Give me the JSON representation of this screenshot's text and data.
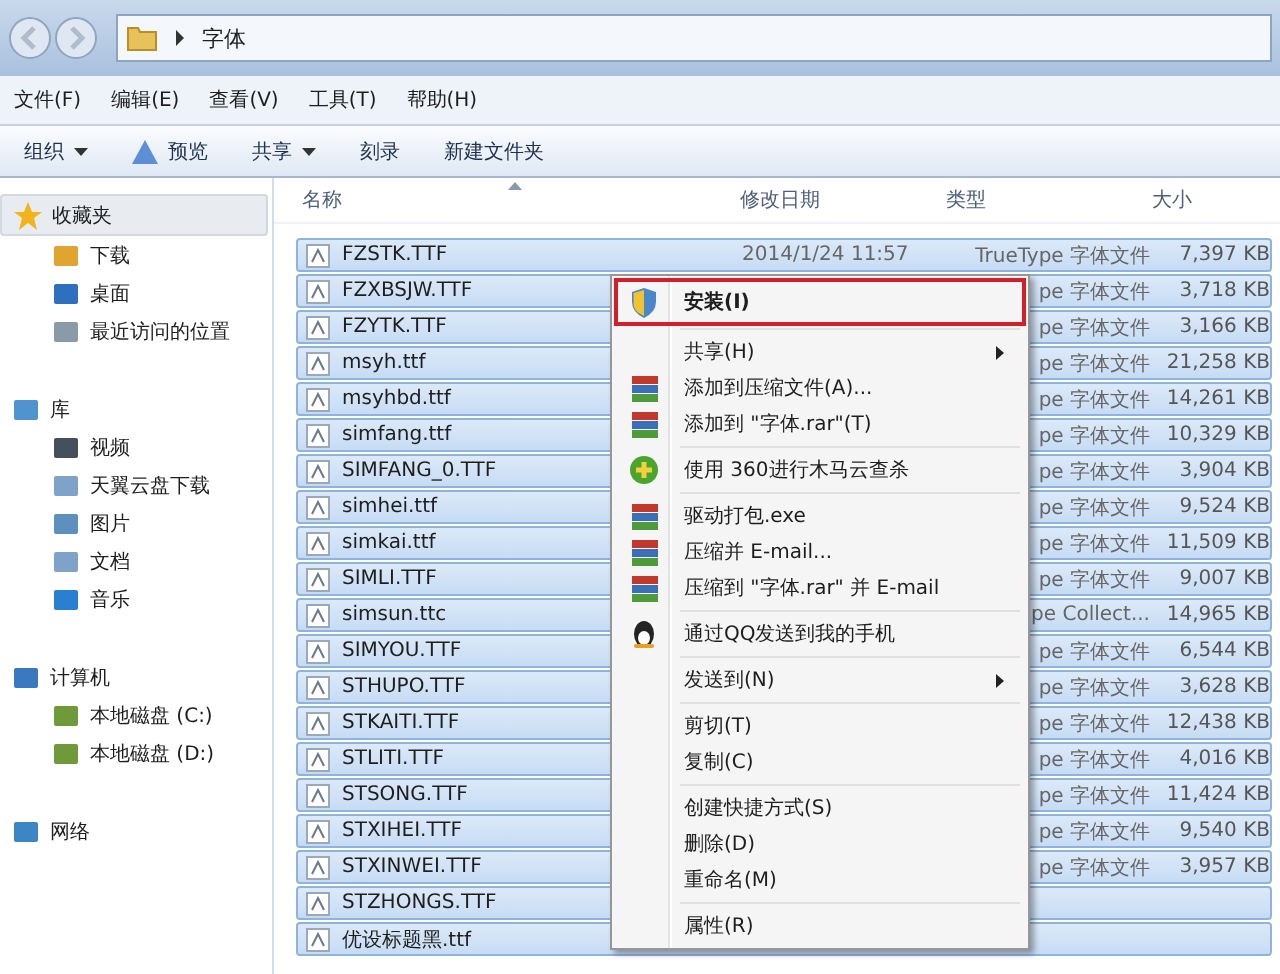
{
  "address": {
    "crumbs": [
      "字体"
    ]
  },
  "menubar": [
    "文件(F)",
    "编辑(E)",
    "查看(V)",
    "工具(T)",
    "帮助(H)"
  ],
  "toolbar": [
    {
      "label": "组织",
      "kind": "dropdown"
    },
    {
      "label": "预览",
      "kind": "preview"
    },
    {
      "label": "共享",
      "kind": "dropdown"
    },
    {
      "label": "刻录",
      "kind": "plain"
    },
    {
      "label": "新建文件夹",
      "kind": "plain"
    }
  ],
  "sidebar": [
    {
      "label": "收藏夹",
      "kind": "star",
      "selected": true,
      "children": [
        {
          "label": "下载",
          "kind": "download",
          "selected": false
        },
        {
          "label": "桌面",
          "kind": "desktop",
          "selected": false
        },
        {
          "label": "最近访问的位置",
          "kind": "recent",
          "selected": false
        }
      ]
    },
    {
      "label": "库",
      "kind": "library",
      "selected": false,
      "children": [
        {
          "label": "视频",
          "kind": "video",
          "selected": false
        },
        {
          "label": "天翼云盘下载",
          "kind": "doc",
          "selected": false
        },
        {
          "label": "图片",
          "kind": "picture",
          "selected": false
        },
        {
          "label": "文档",
          "kind": "doc",
          "selected": false
        },
        {
          "label": "音乐",
          "kind": "music",
          "selected": false
        }
      ]
    },
    {
      "label": "计算机",
      "kind": "computer",
      "selected": false,
      "children": [
        {
          "label": "本地磁盘 (C:)",
          "kind": "drive",
          "selected": false
        },
        {
          "label": "本地磁盘 (D:)",
          "kind": "drive",
          "selected": false
        }
      ]
    },
    {
      "label": "网络",
      "kind": "network",
      "selected": false
    }
  ],
  "table": {
    "columns": [
      {
        "label": "名称",
        "sorted": true
      },
      {
        "label": "修改日期",
        "sorted": false
      },
      {
        "label": "类型",
        "sorted": false
      },
      {
        "label": "大小",
        "sorted": false
      }
    ],
    "rows": [
      {
        "name": "FZSTK.TTF",
        "date": "2014/1/24 11:57",
        "type": "TrueType 字体文件",
        "size": "7,397 KB",
        "selected": true
      },
      {
        "name": "FZXBSJW.TTF",
        "type": "pe 字体文件",
        "size": "3,718 KB",
        "selected": true
      },
      {
        "name": "FZYTK.TTF",
        "type": "pe 字体文件",
        "size": "3,166 KB",
        "selected": true
      },
      {
        "name": "msyh.ttf",
        "type": "pe 字体文件",
        "size": "21,258 KB",
        "selected": true
      },
      {
        "name": "msyhbd.ttf",
        "type": "pe 字体文件",
        "size": "14,261 KB",
        "selected": true
      },
      {
        "name": "simfang.ttf",
        "type": "pe 字体文件",
        "size": "10,329 KB",
        "selected": true
      },
      {
        "name": "SIMFANG_0.TTF",
        "type": "pe 字体文件",
        "size": "3,904 KB",
        "selected": true
      },
      {
        "name": "simhei.ttf",
        "type": "pe 字体文件",
        "size": "9,524 KB",
        "selected": true
      },
      {
        "name": "simkai.ttf",
        "type": "pe 字体文件",
        "size": "11,509 KB",
        "selected": true
      },
      {
        "name": "SIMLI.TTF",
        "type": "pe 字体文件",
        "size": "9,007 KB",
        "selected": true
      },
      {
        "name": "simsun.ttc",
        "type": "pe Collect...",
        "size": "14,965 KB",
        "selected": true
      },
      {
        "name": "SIMYOU.TTF",
        "type": "pe 字体文件",
        "size": "6,544 KB",
        "selected": true
      },
      {
        "name": "STHUPO.TTF",
        "type": "pe 字体文件",
        "size": "3,628 KB",
        "selected": true
      },
      {
        "name": "STKAITI.TTF",
        "type": "pe 字体文件",
        "size": "12,438 KB",
        "selected": true
      },
      {
        "name": "STLITI.TTF",
        "type": "pe 字体文件",
        "size": "4,016 KB",
        "selected": true
      },
      {
        "name": "STSONG.TTF",
        "type": "pe 字体文件",
        "size": "11,424 KB",
        "selected": true
      },
      {
        "name": "STXIHEI.TTF",
        "type": "pe 字体文件",
        "size": "9,540 KB",
        "selected": true
      },
      {
        "name": "STXINWEI.TTF",
        "type": "pe 字体文件",
        "size": "3,957 KB",
        "selected": true
      },
      {
        "name": "STZHONGS.TTF",
        "selected": true
      },
      {
        "name": "优设标题黑.ttf",
        "selected": true
      }
    ]
  },
  "context_menu": [
    {
      "label": "安装(I)",
      "kind": "shield",
      "default": true,
      "highlighted": true
    },
    {
      "kind": "separator"
    },
    {
      "label": "共享(H)",
      "kind": "submenu"
    },
    {
      "label": "添加到压缩文件(A)...",
      "kind": "archive"
    },
    {
      "label": "添加到 \"字体.rar\"(T)",
      "kind": "archive"
    },
    {
      "kind": "separator"
    },
    {
      "label": "使用 360进行木马云查杀",
      "kind": "antivirus"
    },
    {
      "kind": "separator"
    },
    {
      "label": "驱动打包.exe",
      "kind": "archive"
    },
    {
      "label": "压缩并 E-mail...",
      "kind": "archive"
    },
    {
      "label": "压缩到 \"字体.rar\" 并 E-mail",
      "kind": "archive"
    },
    {
      "kind": "separator"
    },
    {
      "label": "通过QQ发送到我的手机",
      "kind": "penguin"
    },
    {
      "kind": "separator"
    },
    {
      "label": "发送到(N)",
      "kind": "submenu"
    },
    {
      "kind": "separator"
    },
    {
      "label": "剪切(T)",
      "kind": "plain"
    },
    {
      "label": "复制(C)",
      "kind": "plain"
    },
    {
      "kind": "separator"
    },
    {
      "label": "创建快捷方式(S)",
      "kind": "plain"
    },
    {
      "label": "删除(D)",
      "kind": "plain"
    },
    {
      "label": "重命名(M)",
      "kind": "plain"
    },
    {
      "kind": "separator"
    },
    {
      "label": "属性(R)",
      "kind": "plain"
    }
  ]
}
